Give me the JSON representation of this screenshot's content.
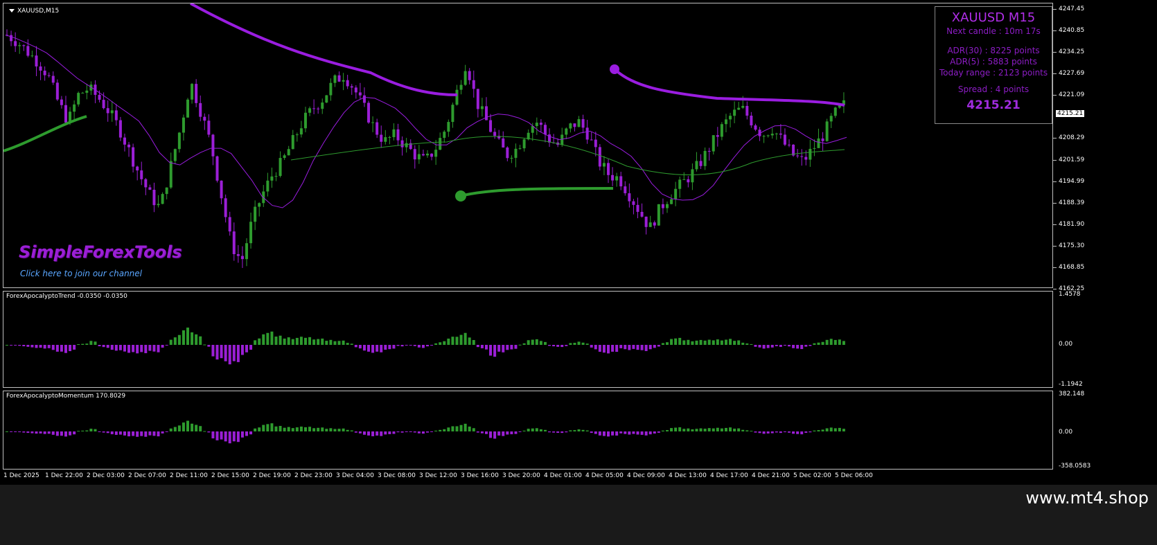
{
  "symbol_title": "XAUUSD,M15",
  "info_box": {
    "title": "XAUUSD M15",
    "next_candle": "Next candle : 10m 17s",
    "adr30": "ADR(30) : 8225 points",
    "adr5": "ADR(5) : 5883 points",
    "today_range": "Today range : 2123 points",
    "spread": "Spread : 4 points",
    "price": "4215.21"
  },
  "brand": "SimpleForexTools",
  "join_link": "Click here to join our channel",
  "price_axis": [
    "4247.45",
    "4240.85",
    "4234.25",
    "4227.69",
    "4221.09",
    "4215.21",
    "4208.29",
    "4201.59",
    "4194.99",
    "4188.39",
    "4181.90",
    "4175.30",
    "4168.85",
    "4162.25"
  ],
  "current_price": "4215.21",
  "trend_indicator": {
    "title": "ForexApocalyptoTrend -0.0350 -0.0350",
    "axis": [
      "1.4578",
      "0.00",
      "-1.1942"
    ]
  },
  "momentum_indicator": {
    "title": "ForexApocalyptoMomentum 170.8029",
    "axis": [
      "382.148",
      "0.00",
      "-358.0583"
    ]
  },
  "time_axis": [
    "1 Dec 2025",
    "1 Dec 22:00",
    "2 Dec 03:00",
    "2 Dec 07:00",
    "2 Dec 11:00",
    "2 Dec 15:00",
    "2 Dec 19:00",
    "2 Dec 23:00",
    "3 Dec 04:00",
    "3 Dec 08:00",
    "3 Dec 12:00",
    "3 Dec 16:00",
    "3 Dec 20:00",
    "4 Dec 01:00",
    "4 Dec 05:00",
    "4 Dec 09:00",
    "4 Dec 13:00",
    "4 Dec 17:00",
    "4 Dec 21:00",
    "5 Dec 02:00",
    "5 Dec 06:00"
  ],
  "watermark": "www.mt4.shop",
  "colors": {
    "bull": "#2e9b2e",
    "bear": "#9b1fd6",
    "neutral": "#c8c8c8",
    "band": "#9a1de0"
  },
  "chart_data": {
    "type": "line",
    "title": "XAUUSD,M15",
    "ylim": [
      4162.25,
      4247.45
    ],
    "series": [
      {
        "values": [
          4238,
          4236,
          4233,
          4230,
          4226,
          4218,
          4212,
          4220,
          4222,
          4219,
          4215,
          4210,
          4203,
          4196,
          4190,
          4186,
          4198,
          4210,
          4224,
          4215,
          4205,
          4190,
          4175,
          4170,
          4182,
          4190,
          4196,
          4200,
          4206,
          4212,
          4216,
          4219,
          4224,
          4226,
          4222,
          4216,
          4210,
          4206,
          4208,
          4205,
          4202,
          4200,
          4204,
          4210,
          4220,
          4230,
          4218,
          4212,
          4206,
          4202,
          4204,
          4210,
          4212,
          4207,
          4205,
          4210,
          4212,
          4208,
          4200,
          4196,
          4195,
          4190,
          4185,
          4180,
          4186,
          4190,
          4193,
          4196,
          4200,
          4205,
          4210,
          4214,
          4216,
          4212,
          4208,
          4210,
          4206,
          4202,
          4200,
          4204,
          4208,
          4214,
          4217
        ]
      }
    ]
  }
}
